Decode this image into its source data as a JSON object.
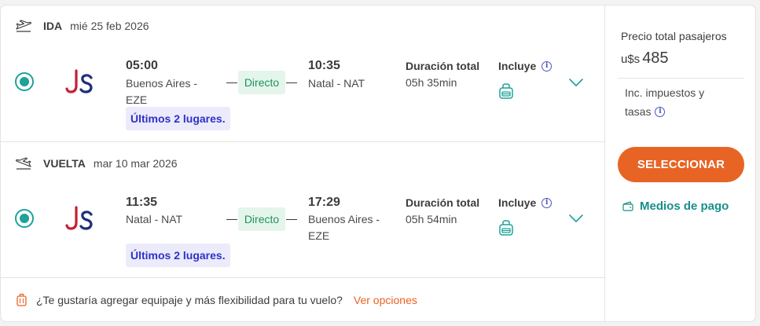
{
  "outbound": {
    "direction": "IDA",
    "date": "mié 25 feb 2026",
    "depart_time": "05:00",
    "depart_place_line1": "Buenos Aires -",
    "depart_place_line2": "EZE",
    "stops_label": "Directo",
    "arrive_time": "10:35",
    "arrive_place_line1": "Natal -  NAT",
    "arrive_place_line2": "",
    "duration_label": "Duración total",
    "duration_value": "05h 35min",
    "includes_label": "Incluye",
    "seats_badge": "Últimos 2 lugares."
  },
  "return": {
    "direction": "VUELTA",
    "date": "mar 10 mar 2026",
    "depart_time": "11:35",
    "depart_place_line1": "Natal -  NAT",
    "depart_place_line2": "",
    "stops_label": "Directo",
    "arrive_time": "17:29",
    "arrive_place_line1": "Buenos Aires -",
    "arrive_place_line2": "EZE",
    "duration_label": "Duración total",
    "duration_value": "05h 54min",
    "includes_label": "Incluye",
    "seats_badge": "Últimos 2 lugares."
  },
  "airline_logo_text": "JS",
  "footer": {
    "question": "¿Te gustaría agregar equipaje y más flexibilidad para tu vuelo?",
    "link": "Ver opciones"
  },
  "price_panel": {
    "title": "Precio total pasajeros",
    "currency": "u$s",
    "amount": "485",
    "tax_line1": "Inc. impuestos y",
    "tax_line2": "tasas",
    "select_button": "SELECCIONAR",
    "payment_link": "Medios de pago"
  },
  "colors": {
    "accent_orange": "#e86424",
    "teal": "#1ea29a",
    "direct_green": "#21935a",
    "badge_blue": "#2e31c6"
  }
}
